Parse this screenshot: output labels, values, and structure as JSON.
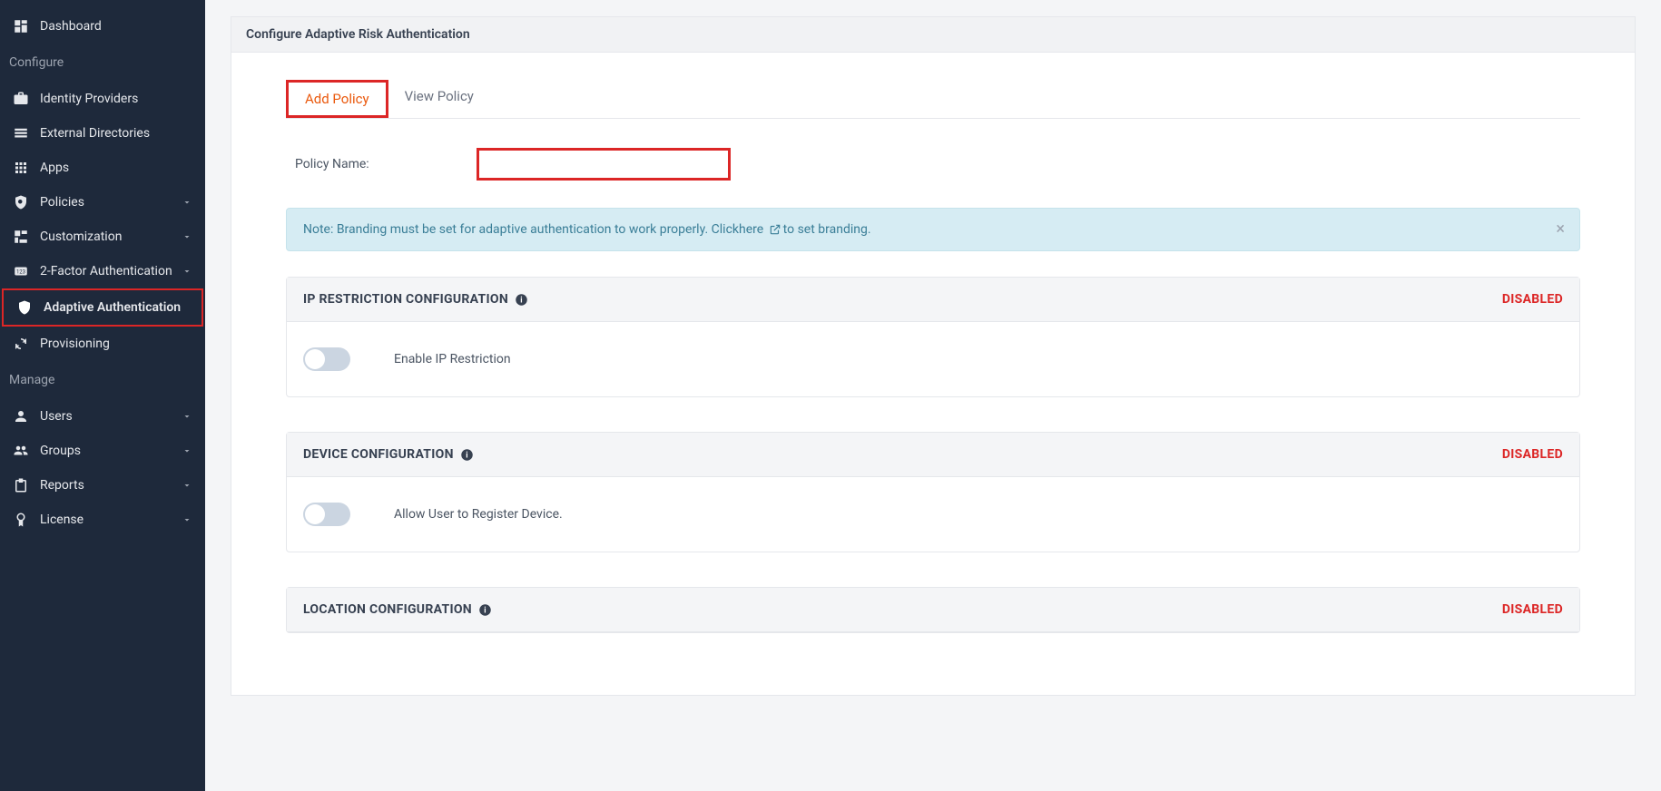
{
  "sidebar": {
    "dashboard": "Dashboard",
    "section_configure": "Configure",
    "identity_providers": "Identity Providers",
    "external_directories": "External Directories",
    "apps": "Apps",
    "policies": "Policies",
    "customization": "Customization",
    "two_factor": "2-Factor Authentication",
    "adaptive_auth": "Adaptive Authentication",
    "provisioning": "Provisioning",
    "section_manage": "Manage",
    "users": "Users",
    "groups": "Groups",
    "reports": "Reports",
    "license": "License"
  },
  "main": {
    "page_title": "Configure Adaptive Risk Authentication",
    "tabs": {
      "add_policy": "Add Policy",
      "view_policy": "View Policy"
    },
    "policy_name_label": "Policy Name:",
    "info_note_prefix": "Note: Branding must be set for adaptive authentication to work properly. Click ",
    "info_note_link": "here",
    "info_note_suffix": " to set branding.",
    "cards": {
      "ip": {
        "title": "IP RESTRICTION CONFIGURATION",
        "status": "DISABLED",
        "toggle_label": "Enable IP Restriction"
      },
      "device": {
        "title": "DEVICE CONFIGURATION",
        "status": "DISABLED",
        "toggle_label": "Allow User to Register Device."
      },
      "location": {
        "title": "LOCATION CONFIGURATION",
        "status": "DISABLED"
      }
    }
  }
}
